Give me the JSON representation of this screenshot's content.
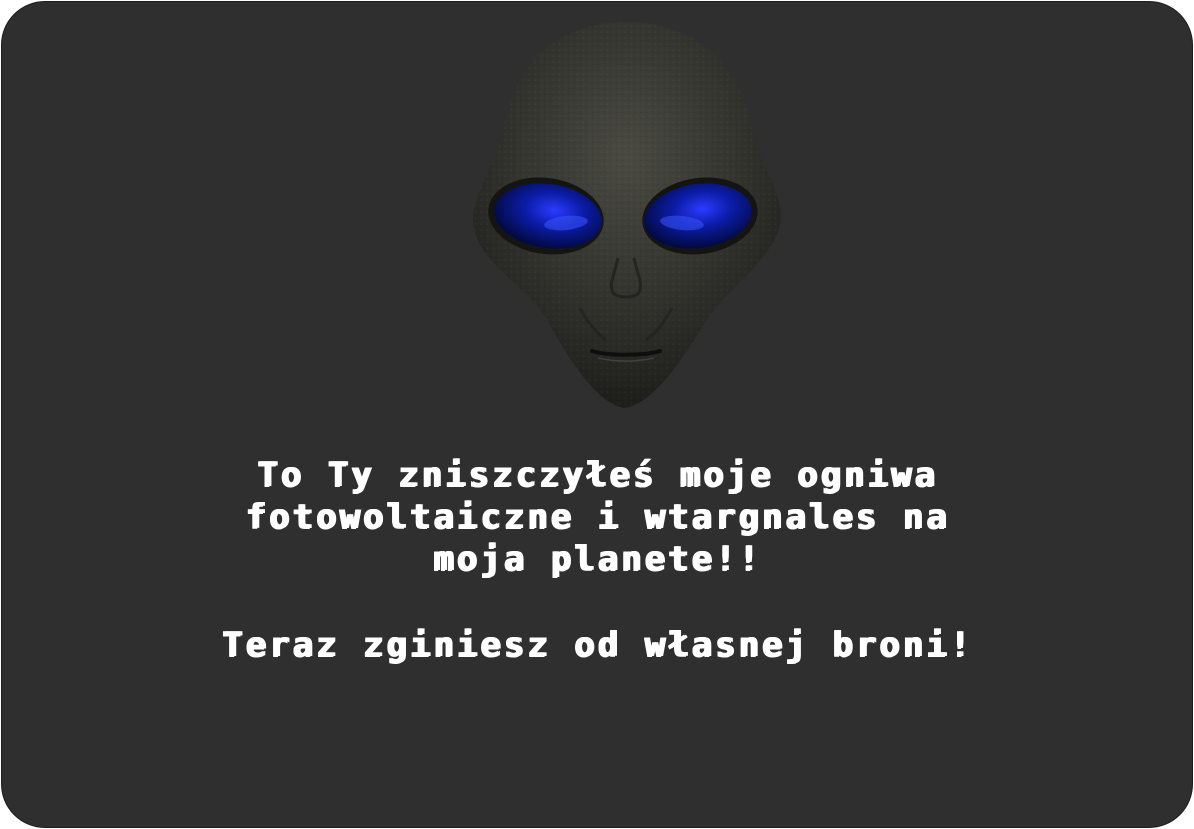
{
  "dialog": {
    "message_lines": [
      "To Ty zniszczyłeś moje ogniwa",
      "fotowoltaiczne i wtargnales na",
      "moja planete!!"
    ],
    "threat": "Teraz zginiesz od własnej broni!"
  },
  "colors": {
    "panel_background": "#2f2f2f",
    "text": "#ffffff",
    "alien_skin": "#3a3a34",
    "alien_eyes": "#0a1a8a"
  },
  "icons": {
    "portrait": "alien-face-icon"
  }
}
